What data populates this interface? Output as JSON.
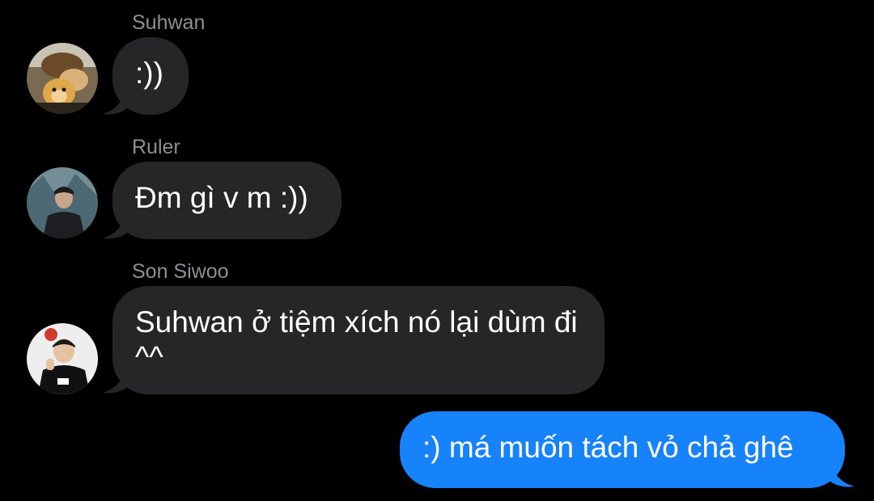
{
  "conversation": {
    "messages": [
      {
        "sender": "Suhwan",
        "text": ":))",
        "direction": "incoming",
        "avatar": "suhwan-avatar"
      },
      {
        "sender": "Ruler",
        "text": "Đm gì v m :))",
        "direction": "incoming",
        "avatar": "ruler-avatar"
      },
      {
        "sender": "Son Siwoo",
        "text": "Suhwan ở tiệm xích nó lại dùm đi ^^",
        "direction": "incoming",
        "avatar": "son-siwoo-avatar"
      },
      {
        "text": ":) má muốn tách vỏ chả ghê",
        "direction": "outgoing"
      }
    ]
  },
  "colors": {
    "background": "#000000",
    "incoming_bubble": "#262628",
    "outgoing_bubble": "#1683fb",
    "sender_name": "#8e8e93",
    "text": "#ffffff"
  }
}
